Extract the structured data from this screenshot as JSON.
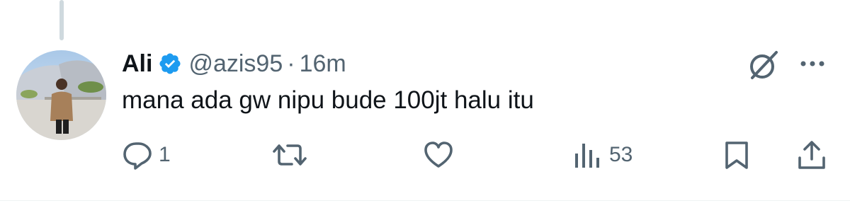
{
  "tweet": {
    "author_name": "Ali",
    "handle": "@azis95",
    "separator": "·",
    "time_ago": "16m",
    "text": "mana ada gw nipu bude 100jt halu itu"
  },
  "actions": {
    "reply_count": "1",
    "views_count": "53"
  },
  "icons": [
    "verified-badge-icon",
    "grok-icon",
    "more-icon",
    "reply-icon",
    "retweet-icon",
    "like-icon",
    "views-icon",
    "bookmark-icon",
    "share-icon"
  ],
  "colors": {
    "verified_blue": "#1d9bf0",
    "muted_text": "#536471",
    "primary_text": "#0f1419"
  }
}
